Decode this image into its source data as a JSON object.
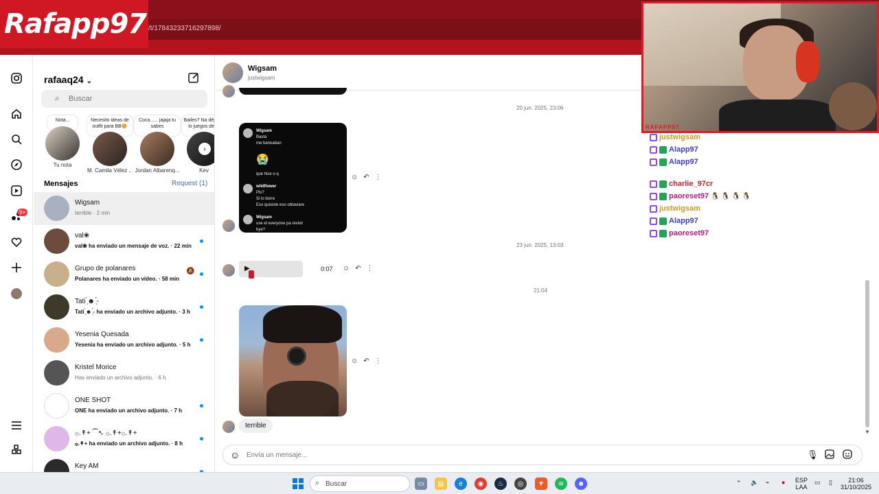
{
  "browser": {
    "url": "/t/17843233716297898/",
    "streamer_logo": "Rafapp97"
  },
  "rail": {
    "items": [
      "instagram-icon",
      "home-icon",
      "search-icon",
      "explore-icon",
      "reels-icon",
      "messages-icon",
      "heart-icon",
      "plus-icon",
      "avatar-icon"
    ],
    "messages_badge": "9+",
    "bottom": [
      "menu-icon",
      "apps-icon"
    ]
  },
  "list": {
    "username": "rafaaq24",
    "search_placeholder": "Buscar",
    "notes": [
      {
        "bubble": "Nota...",
        "name": "Tu nota"
      },
      {
        "bubble": "Necesito ideas de outfit para BB🥺",
        "name": "M. Camila Vélez ..."
      },
      {
        "bubble": "Coca...... jajaja tu sabes",
        "name": "Jordan Albarenq..."
      },
      {
        "bubble": "Bailes? Na déjame lo juegos de te",
        "name": "Kev"
      }
    ],
    "messages_header": "Mensajes",
    "request": "Request (1)",
    "conversations": [
      {
        "name": "Wigsam",
        "snippet": "terrible · 2 min",
        "unread": false,
        "color": "#a9b0bf"
      },
      {
        "name": "val❀",
        "snippet": "val❀ ha enviado un mensaje de voz. · 22 min",
        "unread": true,
        "color": "#6d4c3e"
      },
      {
        "name": "Grupo de polanares",
        "snippet": "Polanares ha enviado un vídeo. · 58 min",
        "unread": true,
        "color": "#c8b08a"
      },
      {
        "name": "Tati ̗̀☻ ̖́-",
        "snippet": "Tati ̗̀☻ ̖́- ha enviado un archivo adjunto. · 3 h",
        "unread": true,
        "color": "#3d3a2a"
      },
      {
        "name": "Yesenia Quesada",
        "snippet": "Yesenia ha enviado un archivo adjunto. · 5 h",
        "unread": true,
        "color": "#d8a98a"
      },
      {
        "name": "Kristel Morice",
        "snippet": "Has enviado un archivo adjunto. · 6 h",
        "unread": false,
        "color": "#555555"
      },
      {
        "name": "ONE SHOT",
        "snippet": "ONE ha enviado un archivo adjunto. · 7 h",
        "unread": true,
        "color": "#ffffff"
      },
      {
        "name": "۞.↟+ ⁀➴ ۞.↟+۞.↟+",
        "snippet": "۞.↟+ ha enviado un archivo adjunto. · 8 h",
        "unread": true,
        "color": "#e0b8e8"
      },
      {
        "name": "Key AM",
        "snippet": "",
        "unread": true,
        "color": "#2a2a2a"
      }
    ]
  },
  "chat": {
    "contact_name": "Wigsam",
    "contact_handle": "justwigsam",
    "stamp1": "20 jun. 2025, 23:06",
    "stamp2": "23 jun. 2025, 13:03",
    "stamp3": "21:04",
    "screenshot_items": [
      {
        "user": "Wigsam",
        "lines": "Basta\nme baneaban"
      },
      {
        "user": "",
        "lines": "que hice o q"
      },
      {
        "user": "wildflower",
        "lines": "Pls?\nSi lo borre\nEso quisiste eso obtaviare"
      },
      {
        "user": "Wigsam",
        "lines": "use el everyone pa revivir\nbye?"
      }
    ],
    "voice_duration": "0:07",
    "last_message": "terrible",
    "composer_placeholder": "Envía un mensaje..."
  },
  "stream": {
    "cam_label": "RAFAPP97",
    "chat": [
      {
        "user": "justwigsam",
        "color": "#c99b1f",
        "badges": "tw",
        "text": ""
      },
      {
        "user": "Alapp97",
        "color": "#3c3cd2",
        "badges": "tw gr",
        "text": ""
      },
      {
        "user": "Alapp97",
        "color": "#3c3cd2",
        "badges": "tw gr",
        "text": ""
      },
      {
        "user": "charlie_97cr",
        "color": "#d2202a",
        "badges": "tw gr",
        "text": ""
      },
      {
        "user": "paoreset97",
        "color": "#c2187a",
        "badges": "tw gr",
        "text": "🐧 🐧 🐧 🐧"
      },
      {
        "user": "justwigsam",
        "color": "#c99b1f",
        "badges": "tw",
        "text": ""
      },
      {
        "user": "Alapp97",
        "color": "#3c3cd2",
        "badges": "tw gr",
        "text": ""
      },
      {
        "user": "paoreset97",
        "color": "#c2187a",
        "badges": "tw gr",
        "text": ""
      }
    ]
  },
  "taskbar": {
    "search": "Buscar",
    "lang1": "ESP",
    "lang2": "LAA",
    "time": "21:06",
    "date": "31/10/2025"
  }
}
